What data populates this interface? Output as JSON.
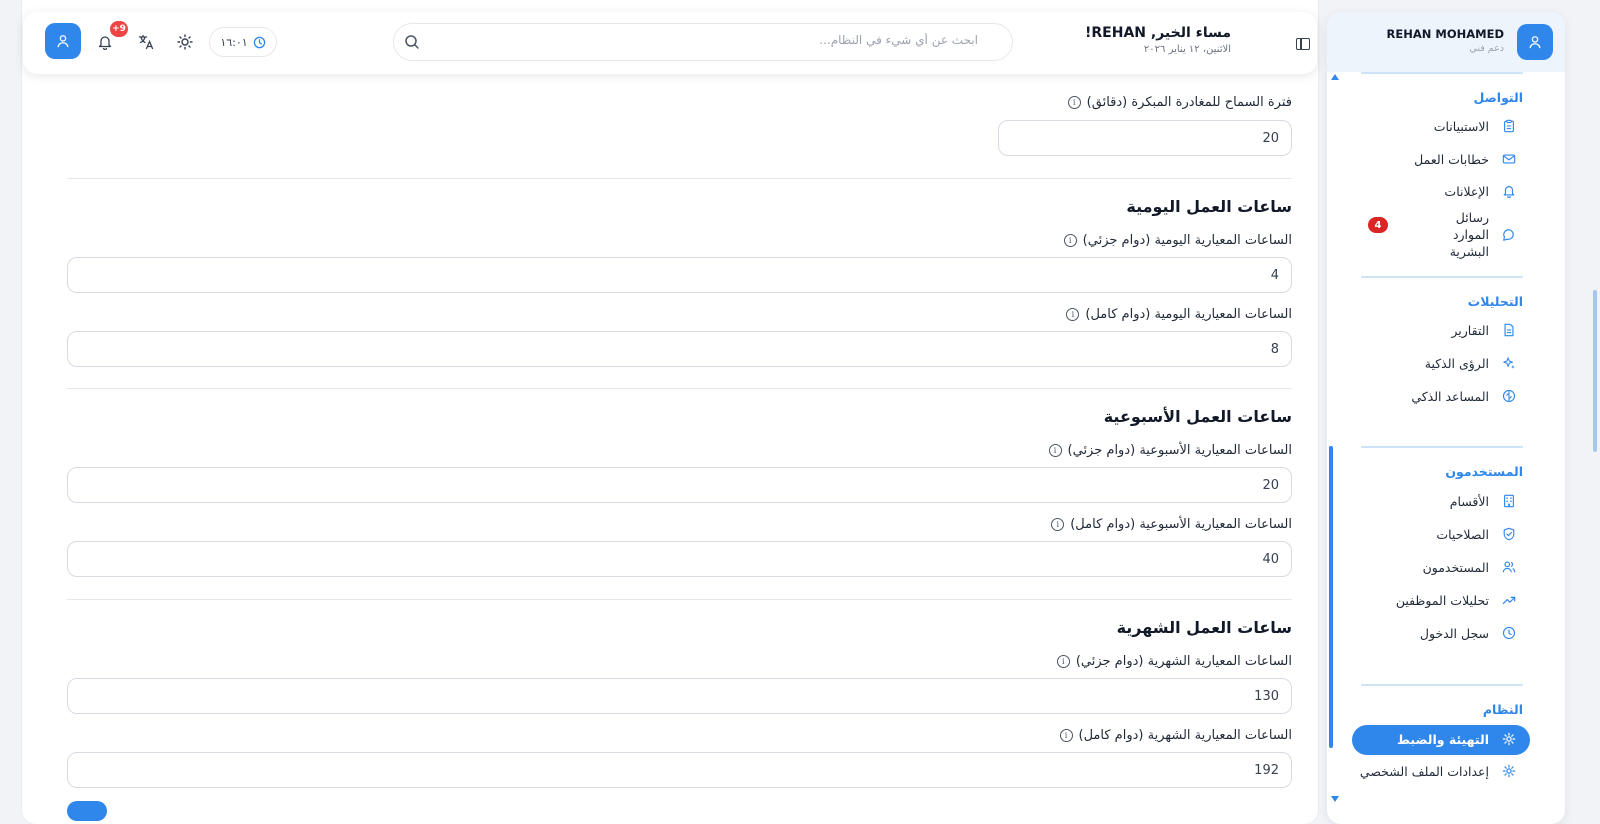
{
  "header": {
    "greeting": "مساء الخير, REHAN!",
    "date": "الاثنين، ١٢ يناير ٢٠٢٦",
    "search_placeholder": "ابحث عن أي شيء في النظام...",
    "clock": "١٦:٠١",
    "notifications_badge": "+9"
  },
  "form": {
    "early_leave_label": "فترة السماح للمغادرة المبكرة (دقائق)",
    "early_leave_value": "20",
    "daily_section": "ساعات العمل اليومية",
    "daily_part_label": "الساعات المعيارية اليومية (دوام جزئي)",
    "daily_part_value": "4",
    "daily_full_label": "الساعات المعيارية اليومية (دوام كامل)",
    "daily_full_value": "8",
    "weekly_section": "ساعات العمل الأسبوعية",
    "weekly_part_label": "الساعات المعيارية الأسبوعية (دوام جزئي)",
    "weekly_part_value": "20",
    "weekly_full_label": "الساعات المعيارية الأسبوعية (دوام كامل)",
    "weekly_full_value": "40",
    "monthly_section": "ساعات العمل الشهرية",
    "monthly_part_label": "الساعات المعيارية الشهرية (دوام جزئي)",
    "monthly_part_value": "130",
    "monthly_full_label": "الساعات المعيارية الشهرية (دوام كامل)",
    "monthly_full_value": "192"
  },
  "sidebar": {
    "user_name": "REHAN MOHAMED",
    "user_role": "دعم فني",
    "groups": {
      "communication": "التواصل",
      "analytics": "التحليلات",
      "users": "المستخدمون",
      "system": "النظام"
    },
    "items": {
      "surveys": "الاستبيانات",
      "work_letters": "خطابات العمل",
      "announcements": "الإعلانات",
      "hr_messages": "رسائل الموارد البشرية",
      "hr_messages_badge": "4",
      "reports": "التقارير",
      "smart_insights": "الرؤى الذكية",
      "smart_assistant": "المساعد الذكي",
      "departments": "الأقسام",
      "permissions": "الصلاحيات",
      "users": "المستخدمون",
      "employee_analytics": "تحليلات الموظفين",
      "login_log": "سجل الدخول",
      "setup": "التهيئة والضبط",
      "profile_settings": "إعدادات الملف الشخصي"
    }
  },
  "colors": {
    "accent": "#2f86eb",
    "badge": "#dc2626"
  }
}
